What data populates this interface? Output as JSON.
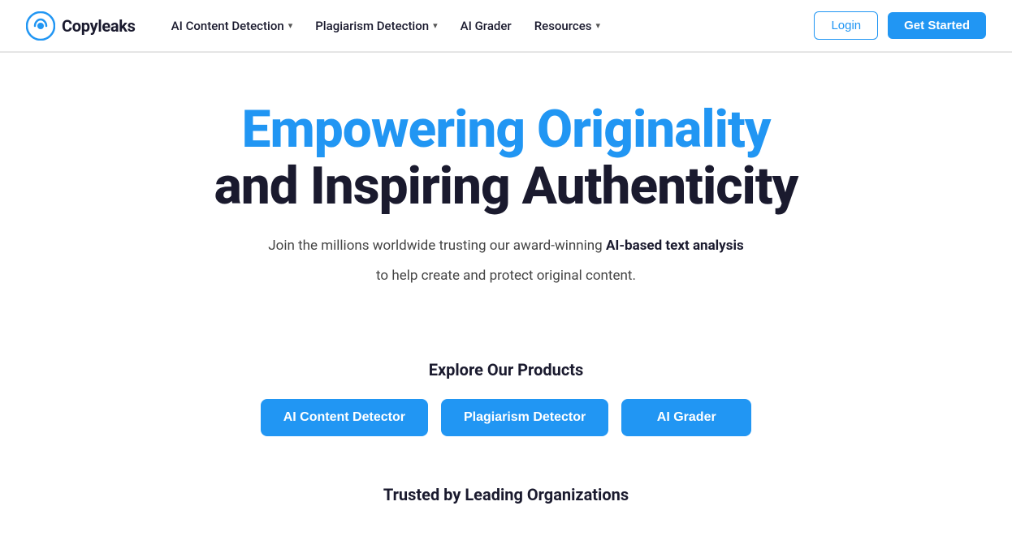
{
  "brand": {
    "name": "Copyleaks",
    "logo_alt": "Copyleaks logo"
  },
  "nav": {
    "items": [
      {
        "label": "AI Content Detection",
        "has_dropdown": true
      },
      {
        "label": "Plagiarism Detection",
        "has_dropdown": true
      },
      {
        "label": "AI Grader",
        "has_dropdown": false
      },
      {
        "label": "Resources",
        "has_dropdown": true
      }
    ],
    "login_label": "Login",
    "get_started_label": "Get Started"
  },
  "hero": {
    "title_line1": "Empowering Originality",
    "title_line2": "and Inspiring Authenticity",
    "subtitle_plain": "Join the millions worldwide trusting our award-winning ",
    "subtitle_bold": "AI-based text analysis",
    "subtitle_line2": "to help create and protect original content."
  },
  "products": {
    "section_title": "Explore Our Products",
    "buttons": [
      {
        "label": "AI Content Detector"
      },
      {
        "label": "Plagiarism Detector"
      },
      {
        "label": "AI Grader"
      }
    ]
  },
  "trusted": {
    "section_title": "Trusted by Leading Organizations"
  }
}
